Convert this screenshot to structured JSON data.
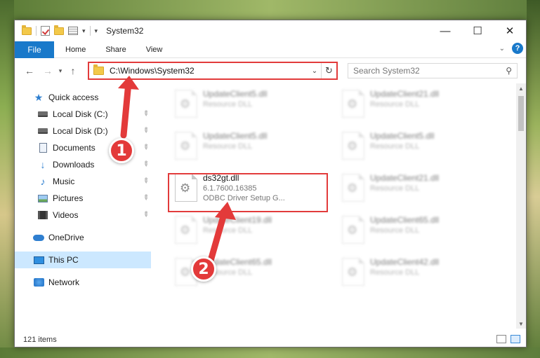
{
  "window": {
    "title": "System32",
    "controls": {
      "minimize": "—",
      "maximize": "☐",
      "close": "✕"
    }
  },
  "ribbon": {
    "tabs": [
      "File",
      "Home",
      "Share",
      "View"
    ],
    "help": "?"
  },
  "address": {
    "path": "C:\\Windows\\System32",
    "search_placeholder": "Search System32"
  },
  "sidebar": {
    "items": [
      {
        "label": "Quick access",
        "icon": "star-icon",
        "pinned": false
      },
      {
        "label": "Local Disk (C:)",
        "icon": "drive-icon",
        "pinned": true
      },
      {
        "label": "Local Disk (D:)",
        "icon": "drive-icon",
        "pinned": true
      },
      {
        "label": "Documents",
        "icon": "documents-icon",
        "pinned": true
      },
      {
        "label": "Downloads",
        "icon": "downloads-icon",
        "pinned": true
      },
      {
        "label": "Music",
        "icon": "music-icon",
        "pinned": true
      },
      {
        "label": "Pictures",
        "icon": "pictures-icon",
        "pinned": true
      },
      {
        "label": "Videos",
        "icon": "videos-icon",
        "pinned": true
      },
      {
        "label": "OneDrive",
        "icon": "onedrive-icon",
        "pinned": false
      },
      {
        "label": "This PC",
        "icon": "this-pc-icon",
        "pinned": false,
        "selected": true
      },
      {
        "label": "Network",
        "icon": "network-icon",
        "pinned": false
      }
    ]
  },
  "files": [
    {
      "name": "UpdateClient5.dll",
      "sub": "Resource DLL",
      "blurred": true
    },
    {
      "name": "UpdateClient21.dll",
      "sub": "Resource DLL",
      "blurred": true
    },
    {
      "name": "UpdateClient5.dll",
      "sub": "Resource DLL",
      "blurred": true
    },
    {
      "name": "UpdateClient5.dll",
      "sub": "Resource DLL",
      "blurred": true
    },
    {
      "name": "ds32gt.dll",
      "sub": "6.1.7600.16385",
      "sub2": "ODBC Driver Setup G...",
      "blurred": false
    },
    {
      "name": "UpdateClient21.dll",
      "sub": "Resource DLL",
      "blurred": true
    },
    {
      "name": "UpdateClient19.dll",
      "sub": "Resource DLL",
      "blurred": true
    },
    {
      "name": "UpdateClient65.dll",
      "sub": "Resource DLL",
      "blurred": true
    },
    {
      "name": "UpdateClient65.dll",
      "sub": "Resource DLL",
      "blurred": true
    },
    {
      "name": "UpdateClient42.dll",
      "sub": "Resource DLL",
      "blurred": true
    }
  ],
  "status": {
    "item_count": "121 items"
  },
  "annotations": {
    "step1": "1",
    "step2": "2"
  },
  "colors": {
    "accent": "#1979ca",
    "highlight": "#e23b3b",
    "selected": "#cce8ff"
  }
}
